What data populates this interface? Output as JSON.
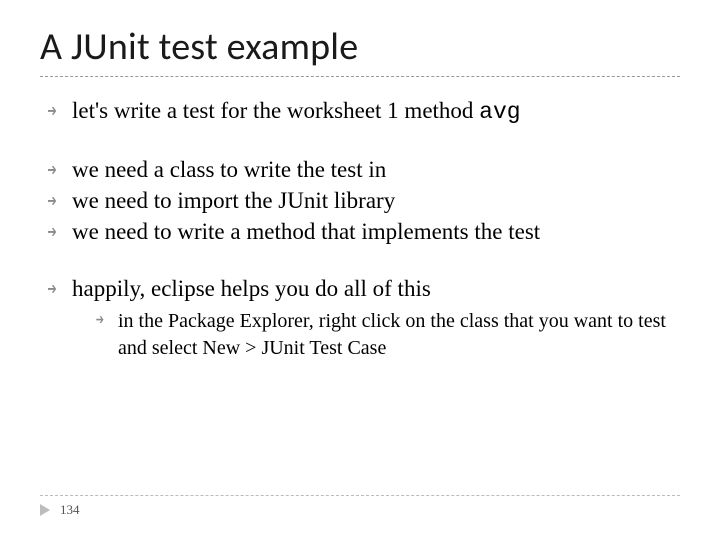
{
  "title": "A JUnit test example",
  "bullets": {
    "b0": "let's write a test for the worksheet 1 method ",
    "b0_code": "avg",
    "b1": "we need a class to write the test in",
    "b2": "we need to import the JUnit library",
    "b3": "we need to write a method that implements the test",
    "b4": "happily, eclipse helps you do all of this",
    "b4_sub0": "in the Package Explorer, right click on the class that you want to test and select New > JUnit Test Case"
  },
  "page_number": "134"
}
